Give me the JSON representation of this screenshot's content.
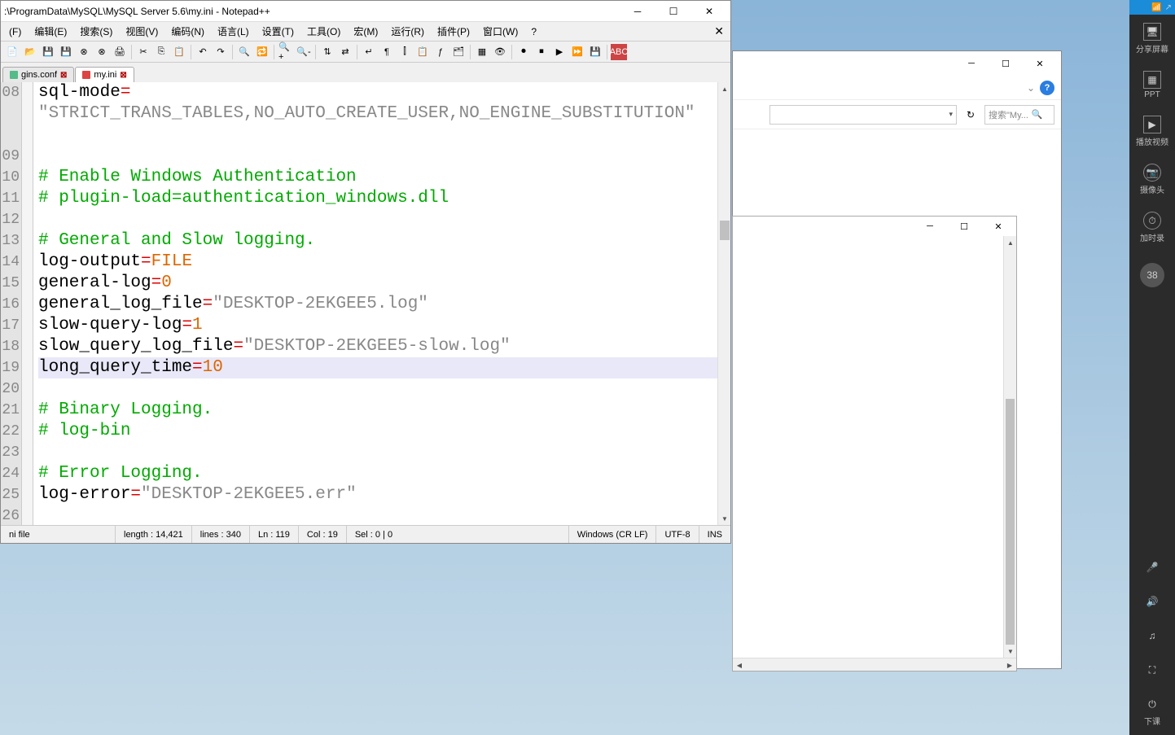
{
  "window": {
    "title": ":\\ProgramData\\MySQL\\MySQL Server 5.6\\my.ini - Notepad++"
  },
  "menu": {
    "file": "(F)",
    "edit": "编辑(E)",
    "search": "搜索(S)",
    "view": "视图(V)",
    "encoding": "编码(N)",
    "language": "语言(L)",
    "settings": "设置(T)",
    "tools": "工具(O)",
    "macro": "宏(M)",
    "run": "运行(R)",
    "plugins": "插件(P)",
    "window": "窗口(W)",
    "help": "?"
  },
  "tabs": {
    "tab1": "gins.conf",
    "tab2": "my.ini"
  },
  "lines": {
    "ln08": "08",
    "ln09": "09",
    "ln10": "10",
    "ln11": "11",
    "ln12": "12",
    "ln13": "13",
    "ln14": "14",
    "ln15": "15",
    "ln16": "16",
    "ln17": "17",
    "ln18": "18",
    "ln19": "19",
    "ln20": "20",
    "ln21": "21",
    "ln22": "22",
    "ln23": "23",
    "ln24": "24",
    "ln25": "25",
    "ln26": "26"
  },
  "code": {
    "l08_key": "sql-mode",
    "l08_eq": "=",
    "l08b_val": "\"STRICT_TRANS_TABLES,NO_AUTO_CREATE_USER,NO_ENGINE_SUBSTITUTION\"",
    "l10_cmt": "# Enable Windows Authentication",
    "l11_cmt": "# plugin-load=authentication_windows.dll",
    "l13_cmt": "# General and Slow logging.",
    "l14_key": "log-output",
    "l14_eq": "=",
    "l14_val": "FILE",
    "l15_key": "general-log",
    "l15_eq": "=",
    "l15_val": "0",
    "l16_key": "general_log_file",
    "l16_eq": "=",
    "l16_val": "\"DESKTOP-2EKGEE5.log\"",
    "l17_key": "slow-query-log",
    "l17_eq": "=",
    "l17_val": "1",
    "l18_key": "slow_query_log_file",
    "l18_eq": "=",
    "l18_val": "\"DESKTOP-2EKGEE5-slow.log\"",
    "l19_key": "long_query_time",
    "l19_eq": "=",
    "l19_val": "10",
    "l21_cmt": "# Binary Logging.",
    "l22_cmt": "# log-bin",
    "l24_cmt": "# Error Logging.",
    "l25_key": "log-error",
    "l25_eq": "=",
    "l25_val": "\"DESKTOP-2EKGEE5.err\""
  },
  "status": {
    "type": "ni file",
    "length": "length : 14,421",
    "lines": "lines : 340",
    "ln": "Ln : 119",
    "col": "Col : 19",
    "sel": "Sel : 0 | 0",
    "eol": "Windows (CR LF)",
    "enc": "UTF-8",
    "ins": "INS"
  },
  "explorer": {
    "search_placeholder": "搜索\"My..."
  },
  "sidebar": {
    "share": "分享屏幕",
    "ppt": "PPT",
    "video": "播放视频",
    "camera": "摄像头",
    "timer": "加时录",
    "badge": "38",
    "exit": "下课"
  }
}
